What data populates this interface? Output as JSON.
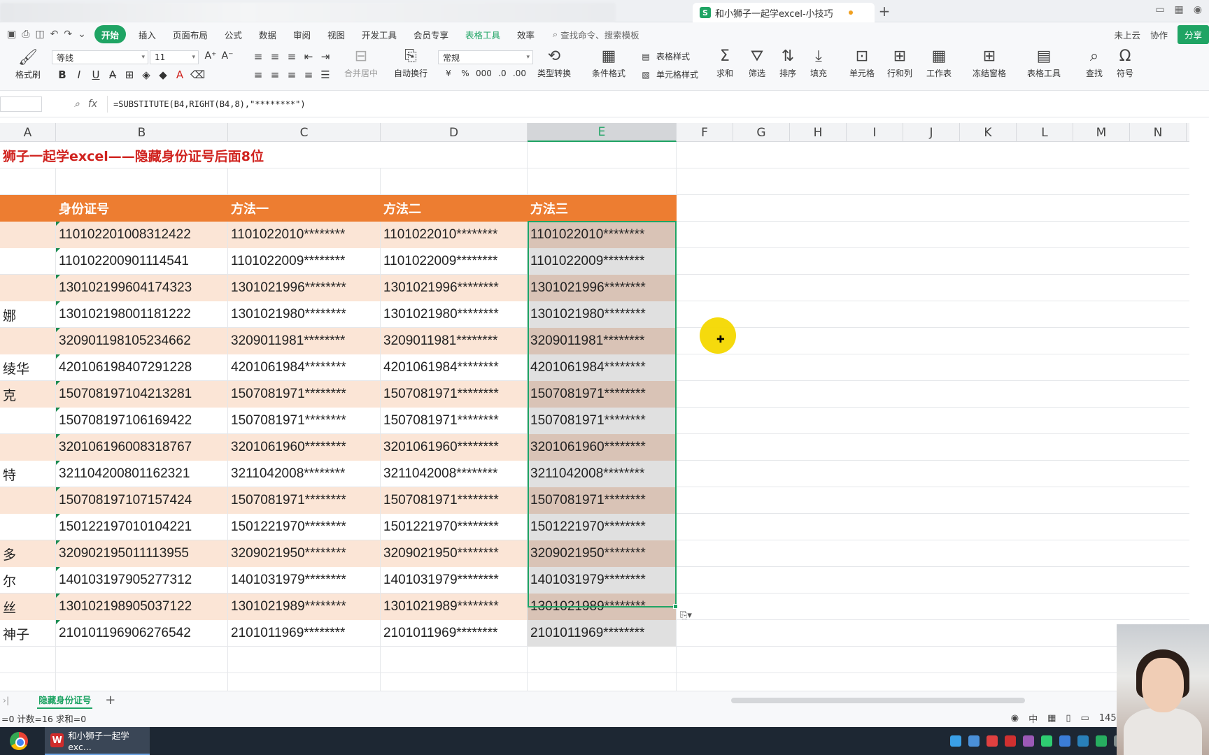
{
  "window": {
    "tab_title": "和小狮子一起学excel-小技巧",
    "wps_logo": "S"
  },
  "menu": {
    "items": [
      "开始",
      "插入",
      "页面布局",
      "公式",
      "数据",
      "审阅",
      "视图",
      "开发工具",
      "会员专享",
      "表格工具",
      "效率"
    ],
    "search_placeholder": "查找命令、搜索模板",
    "cloud": "未上云",
    "collab": "协作",
    "share": "分享"
  },
  "ribbon": {
    "format_painter": "格式刷",
    "font_name": "等线",
    "font_size": "11",
    "merge_center": "合并居中",
    "wrap": "自动换行",
    "number_format": "常规",
    "type_convert": "类型转换",
    "cond_format": "条件格式",
    "table_style": "表格样式",
    "cell_style": "单元格样式",
    "sum": "求和",
    "filter": "筛选",
    "sort": "排序",
    "fill": "填充",
    "cell": "单元格",
    "rowcol": "行和列",
    "worksheet": "工作表",
    "freeze": "冻结窗格",
    "table_tools": "表格工具",
    "find": "查找",
    "symbol": "符号"
  },
  "formula_bar": {
    "fx": "fx",
    "formula": "=SUBSTITUTE(B4,RIGHT(B4,8),\"********\")"
  },
  "columns": [
    "A",
    "B",
    "C",
    "D",
    "E",
    "F",
    "G",
    "H",
    "I",
    "J",
    "K",
    "L",
    "M",
    "N"
  ],
  "sheet": {
    "title": "狮子一起学excel——隐藏身份证号后面8位",
    "headers": [
      "",
      "身份证号",
      "方法一",
      "方法二",
      "方法三"
    ],
    "rows": [
      {
        "name": "",
        "id": "110102201008312422",
        "m1": "1101022010********",
        "m2": "1101022010********",
        "m3": "1101022010********"
      },
      {
        "name": "",
        "id": "110102200901114541",
        "m1": "1101022009********",
        "m2": "1101022009********",
        "m3": "1101022009********"
      },
      {
        "name": "",
        "id": "130102199604174323",
        "m1": "1301021996********",
        "m2": "1301021996********",
        "m3": "1301021996********"
      },
      {
        "name": "娜",
        "id": "130102198001181222",
        "m1": "1301021980********",
        "m2": "1301021980********",
        "m3": "1301021980********"
      },
      {
        "name": "",
        "id": "320901198105234662",
        "m1": "3209011981********",
        "m2": "3209011981********",
        "m3": "3209011981********"
      },
      {
        "name": "绫华",
        "id": "420106198407291228",
        "m1": "4201061984********",
        "m2": "4201061984********",
        "m3": "4201061984********"
      },
      {
        "name": "克",
        "id": "150708197104213281",
        "m1": "1507081971********",
        "m2": "1507081971********",
        "m3": "1507081971********"
      },
      {
        "name": "",
        "id": "150708197106169422",
        "m1": "1507081971********",
        "m2": "1507081971********",
        "m3": "1507081971********"
      },
      {
        "name": "",
        "id": "320106196008318767",
        "m1": "3201061960********",
        "m2": "3201061960********",
        "m3": "3201061960********"
      },
      {
        "name": "特",
        "id": "321104200801162321",
        "m1": "3211042008********",
        "m2": "3211042008********",
        "m3": "3211042008********"
      },
      {
        "name": "",
        "id": "150708197107157424",
        "m1": "1507081971********",
        "m2": "1507081971********",
        "m3": "1507081971********"
      },
      {
        "name": "",
        "id": "150122197010104221",
        "m1": "1501221970********",
        "m2": "1501221970********",
        "m3": "1501221970********"
      },
      {
        "name": "多",
        "id": "320902195011113955",
        "m1": "3209021950********",
        "m2": "3209021950********",
        "m3": "3209021950********"
      },
      {
        "name": "尔",
        "id": "140103197905277312",
        "m1": "1401031979********",
        "m2": "1401031979********",
        "m3": "1401031979********"
      },
      {
        "name": "丝",
        "id": "130102198905037122",
        "m1": "1301021989********",
        "m2": "1301021989********",
        "m3": "1301021989********"
      },
      {
        "name": "神子",
        "id": "210101196906276542",
        "m1": "2101011969********",
        "m2": "2101011969********",
        "m3": "2101011969********"
      }
    ]
  },
  "sheet_tab": "隐藏身份证号",
  "status": {
    "left": "=0  计数=16  求和=0",
    "zoom": "145%",
    "ime": "中"
  },
  "taskbar": {
    "app": "和小狮子一起学exc...",
    "wps_glyph": "W"
  },
  "colors": {
    "header_orange": "#ed7d31",
    "row_peach": "#fbe5d6",
    "title_red": "#d0231f",
    "accent_green": "#1fa464"
  }
}
